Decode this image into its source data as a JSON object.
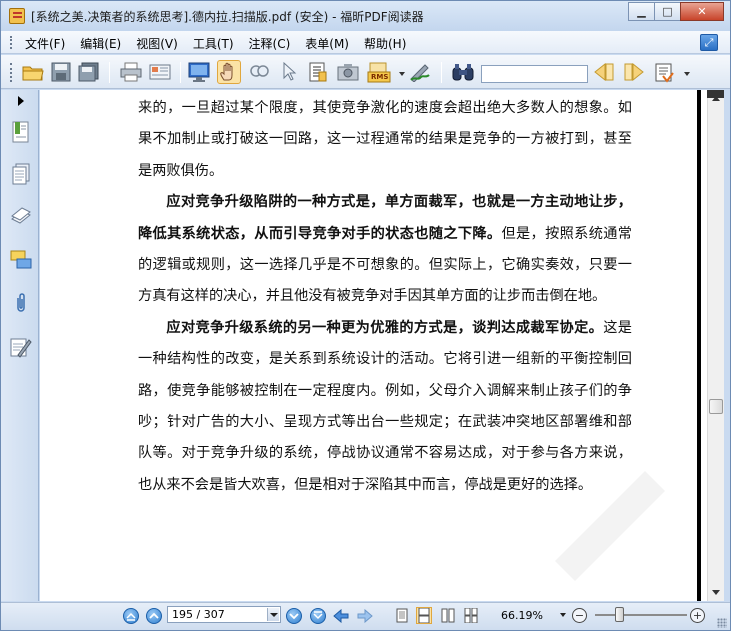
{
  "window": {
    "title": "[系统之美.决策者的系统思考].德内拉.扫描版.pdf (安全) - 福昕PDF阅读器",
    "minimize_label": "▁",
    "maximize_label": "□",
    "close_label": "✕"
  },
  "menu": {
    "items": [
      {
        "label": "文件(F)"
      },
      {
        "label": "编辑(E)"
      },
      {
        "label": "视图(V)"
      },
      {
        "label": "工具(T)"
      },
      {
        "label": "注释(C)"
      },
      {
        "label": "表单(M)"
      },
      {
        "label": "帮助(H)"
      }
    ]
  },
  "toolbar": {
    "icons": [
      "open-folder-icon",
      "save-icon",
      "save-all-icon",
      "print-icon",
      "email-icon",
      "fullscreen-icon",
      "hand-tool-icon",
      "zoom-tool-icon",
      "select-arrow-icon",
      "text-select-icon",
      "snapshot-icon",
      "rms-icon",
      "sign-icon",
      "find-binoculars-icon",
      "search-prev-icon",
      "search-next-icon",
      "search-options-icon"
    ],
    "rms_label": "RMS",
    "search_value": ""
  },
  "sidebar": {
    "icons": [
      "bookmarks-icon",
      "pages-icon",
      "layers-icon",
      "comments-icon",
      "attachments-icon",
      "signatures-icon"
    ]
  },
  "document": {
    "paragraphs": [
      {
        "indent": false,
        "bold": "",
        "text": "来的，一旦超过某个限度，其使竞争激化的速度会超出绝大多数人的想象。如果不加制止或打破这一回路，这一过程通常的结果是竞争的一方被打到，甚至是两败俱伤。"
      },
      {
        "indent": true,
        "bold": "应对竞争升级陷阱的一种方式是，单方面裁军，也就是一方主动地让步，降低其系统状态，从而引导竞争对手的状态也随之下降。",
        "text": "但是，按照系统通常的逻辑或规则，这一选择几乎是不可想象的。但实际上，它确实奏效，只要一方真有这样的决心，并且他没有被竞争对手因其单方面的让步而击倒在地。"
      },
      {
        "indent": true,
        "bold": "应对竞争升级系统的另一种更为优雅的方式是，谈判达成裁军协定。",
        "text": "这是一种结构性的改变，是关系到系统设计的活动。它将引进一组新的平衡控制回路，使竞争能够被控制在一定程度内。例如，父母介入调解来制止孩子们的争吵；针对广告的大小、呈现方式等出台一些规定；在武装冲突地区部署维和部队等。对于竞争升级的系统，停战协议通常不容易达成，对于参与各方来说，也从来不会是皆大欢喜，但是相对于深陷其中而言，停战是更好的选择。"
      }
    ]
  },
  "statusbar": {
    "page_display": "195 / 307",
    "current_page": 195,
    "total_pages": 307,
    "zoom_label": "66.19%",
    "zoom_minus": "−",
    "zoom_plus": "+"
  },
  "scroll": {
    "position_fraction": 0.633
  },
  "zoom_slider": {
    "fraction": 0.26
  }
}
